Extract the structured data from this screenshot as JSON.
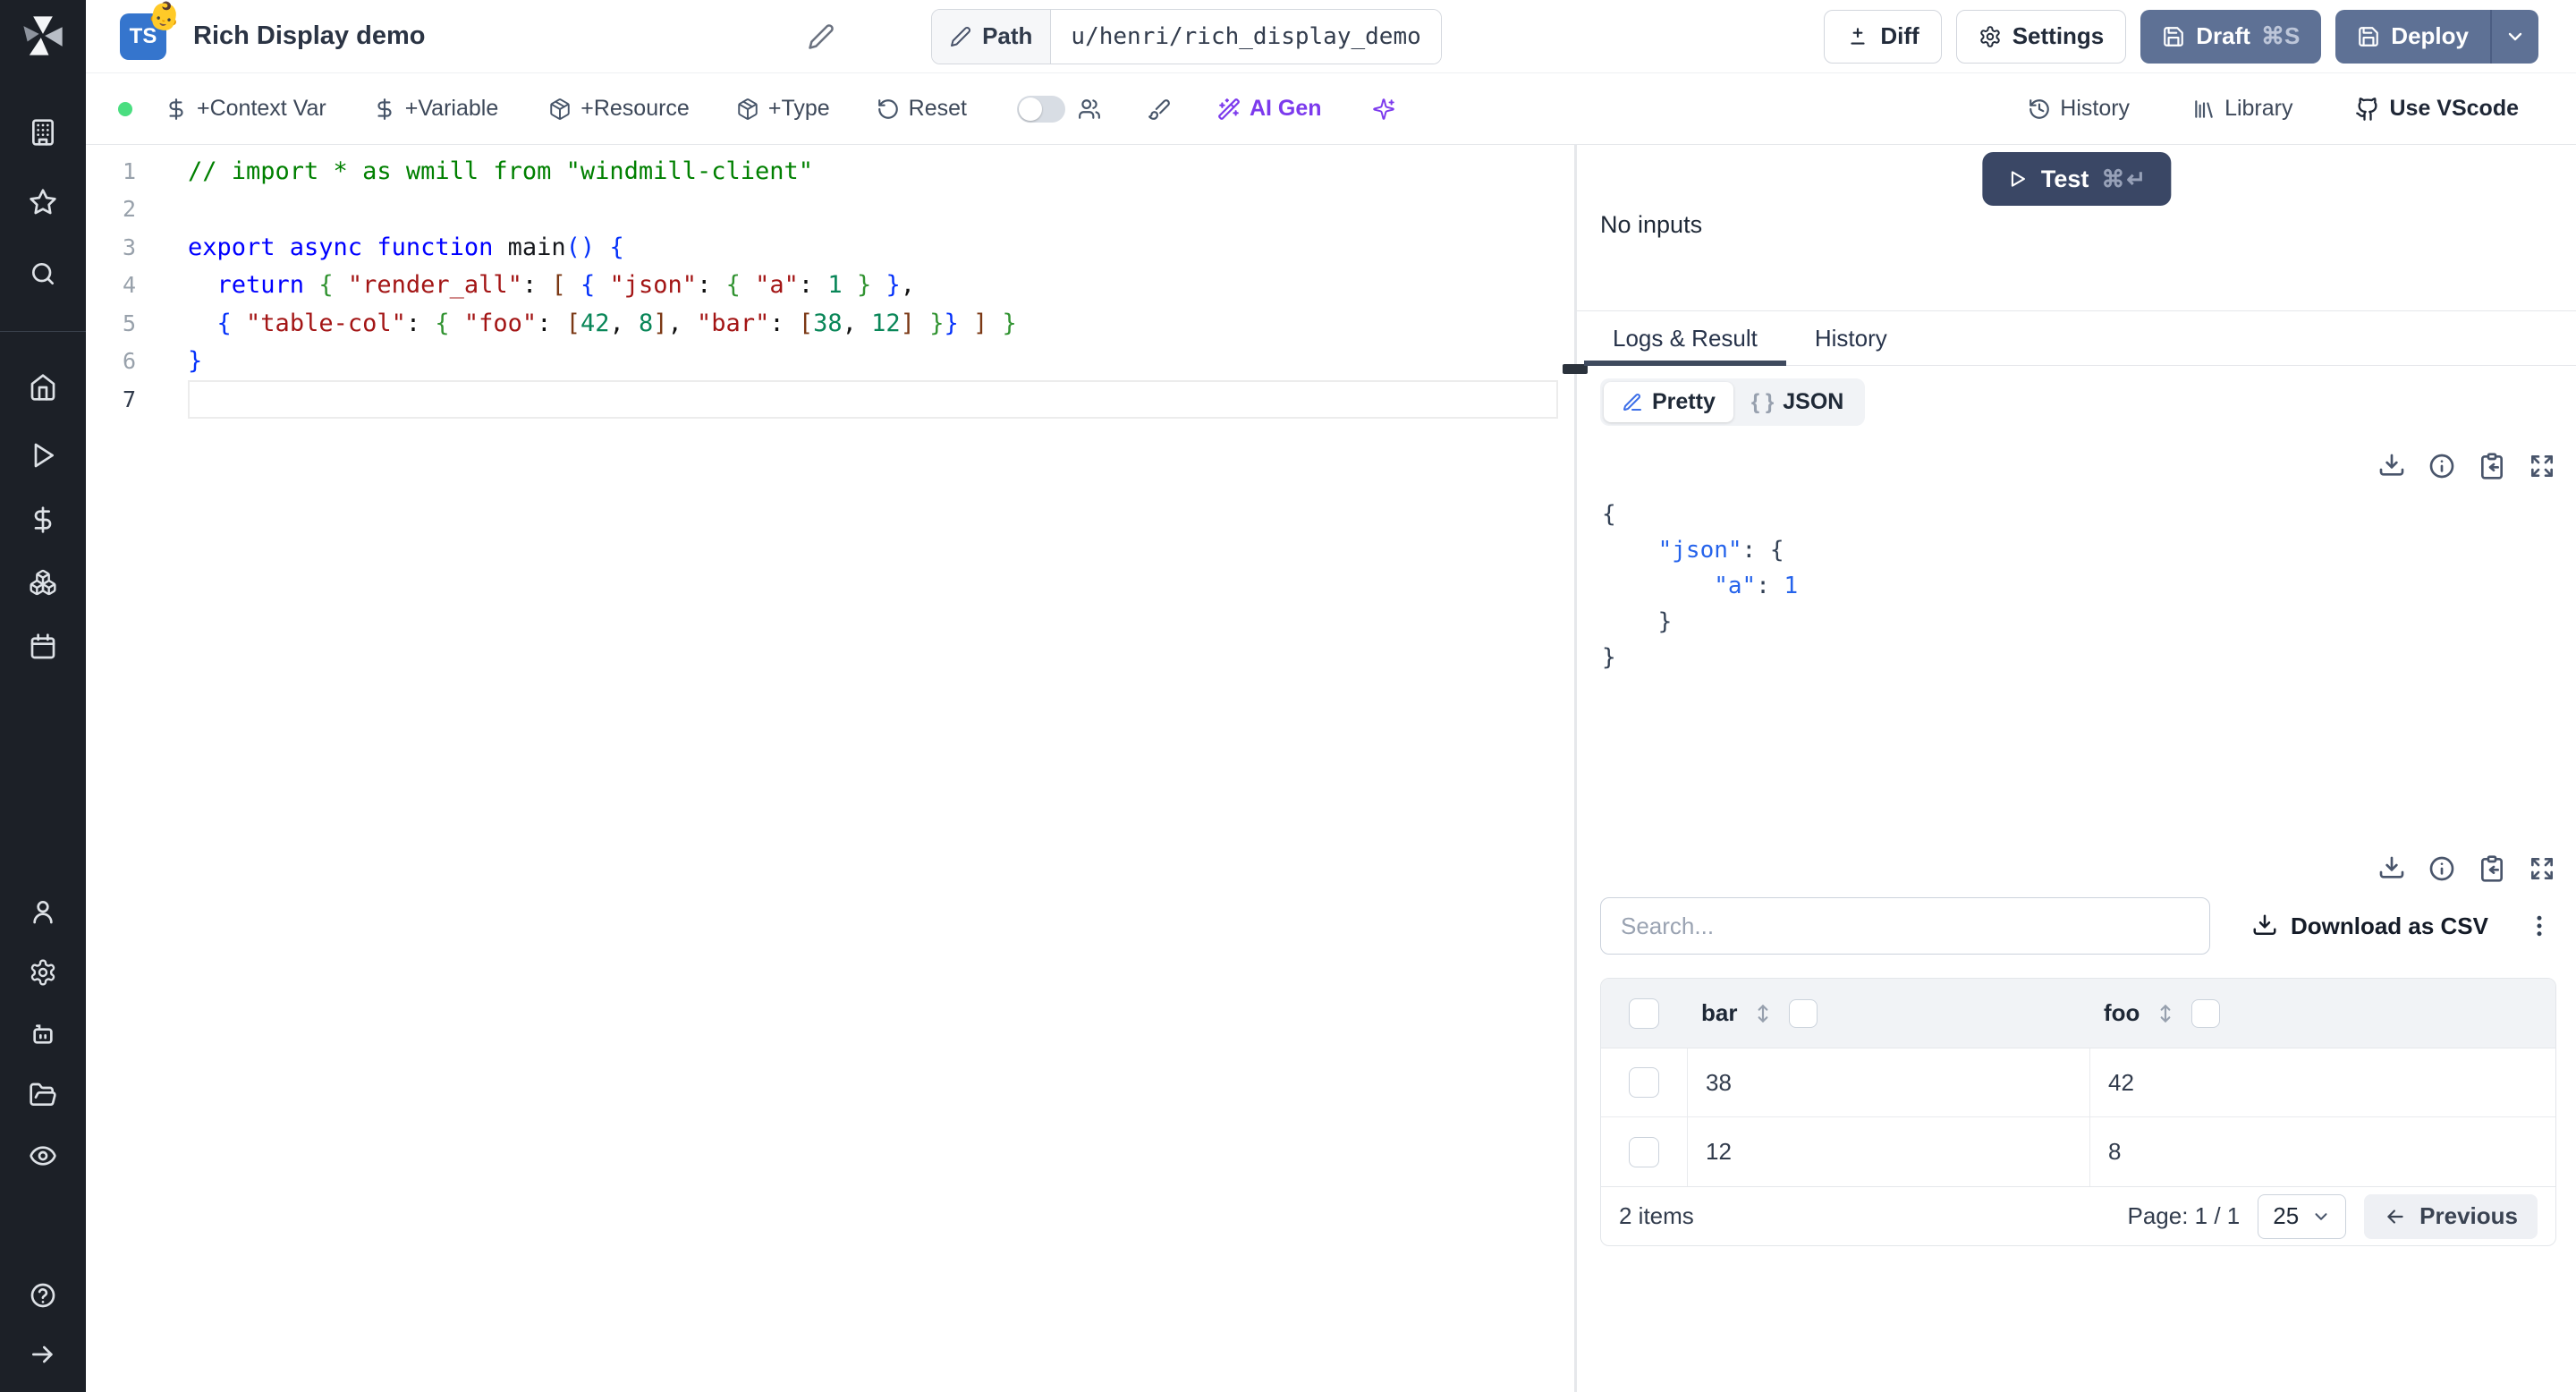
{
  "header": {
    "ts_badge": "TS",
    "emoji": "👶",
    "title": "Rich Display demo",
    "path": {
      "label": "Path",
      "value": "u/henri/rich_display_demo"
    },
    "buttons": {
      "diff": "Diff",
      "settings": "Settings",
      "draft": "Draft",
      "draft_shortcut": "⌘S",
      "deploy": "Deploy"
    }
  },
  "toolbar": {
    "context_var": "+Context Var",
    "variable": "+Variable",
    "resource": "+Resource",
    "type": "+Type",
    "reset": "Reset",
    "ai_gen": "AI Gen",
    "history": "History",
    "library": "Library",
    "vscode": "Use VScode"
  },
  "sidebar": {
    "icons": [
      "windmill-logo",
      "building",
      "star",
      "search",
      "home",
      "play",
      "dollar",
      "boxes",
      "calendar",
      "user",
      "gear",
      "bot",
      "folder-open",
      "eye",
      "help",
      "arrow-right"
    ]
  },
  "editor": {
    "line_numbers": [
      "1",
      "2",
      "3",
      "4",
      "5",
      "6",
      "7"
    ],
    "active_line": 7,
    "lines": [
      [
        {
          "c": "cmt",
          "t": "// import * as wmill from \"windmill-client\""
        }
      ],
      [],
      [
        {
          "c": "kw",
          "t": "export async function "
        },
        {
          "c": "fn",
          "t": "main"
        },
        {
          "c": "b1",
          "t": "()"
        },
        {
          "c": "txt",
          "t": " "
        },
        {
          "c": "b1",
          "t": "{"
        }
      ],
      [
        {
          "c": "txt",
          "t": "  "
        },
        {
          "c": "kw",
          "t": "return"
        },
        {
          "c": "txt",
          "t": " "
        },
        {
          "c": "b2",
          "t": "{"
        },
        {
          "c": "txt",
          "t": " "
        },
        {
          "c": "str",
          "t": "\"render_all\""
        },
        {
          "c": "txt",
          "t": ": "
        },
        {
          "c": "b3",
          "t": "["
        },
        {
          "c": "txt",
          "t": " "
        },
        {
          "c": "b1",
          "t": "{"
        },
        {
          "c": "txt",
          "t": " "
        },
        {
          "c": "str",
          "t": "\"json\""
        },
        {
          "c": "txt",
          "t": ": "
        },
        {
          "c": "b2",
          "t": "{"
        },
        {
          "c": "txt",
          "t": " "
        },
        {
          "c": "str",
          "t": "\"a\""
        },
        {
          "c": "txt",
          "t": ": "
        },
        {
          "c": "num",
          "t": "1"
        },
        {
          "c": "txt",
          "t": " "
        },
        {
          "c": "b2",
          "t": "}"
        },
        {
          "c": "txt",
          "t": " "
        },
        {
          "c": "b1",
          "t": "}"
        },
        {
          "c": "txt",
          "t": ","
        }
      ],
      [
        {
          "c": "txt",
          "t": "  "
        },
        {
          "c": "b1",
          "t": "{"
        },
        {
          "c": "txt",
          "t": " "
        },
        {
          "c": "str",
          "t": "\"table-col\""
        },
        {
          "c": "txt",
          "t": ": "
        },
        {
          "c": "b2",
          "t": "{"
        },
        {
          "c": "txt",
          "t": " "
        },
        {
          "c": "str",
          "t": "\"foo\""
        },
        {
          "c": "txt",
          "t": ": "
        },
        {
          "c": "b3",
          "t": "["
        },
        {
          "c": "num",
          "t": "42"
        },
        {
          "c": "txt",
          "t": ", "
        },
        {
          "c": "num",
          "t": "8"
        },
        {
          "c": "b3",
          "t": "]"
        },
        {
          "c": "txt",
          "t": ", "
        },
        {
          "c": "str",
          "t": "\"bar\""
        },
        {
          "c": "txt",
          "t": ": "
        },
        {
          "c": "b3",
          "t": "["
        },
        {
          "c": "num",
          "t": "38"
        },
        {
          "c": "txt",
          "t": ", "
        },
        {
          "c": "num",
          "t": "12"
        },
        {
          "c": "b3",
          "t": "]"
        },
        {
          "c": "txt",
          "t": " "
        },
        {
          "c": "b2",
          "t": "}"
        },
        {
          "c": "b1",
          "t": "}"
        },
        {
          "c": "txt",
          "t": " "
        },
        {
          "c": "b3",
          "t": "]"
        },
        {
          "c": "txt",
          "t": " "
        },
        {
          "c": "b2",
          "t": "}"
        }
      ],
      [
        {
          "c": "b1",
          "t": "}"
        }
      ],
      []
    ]
  },
  "run_panel": {
    "test": "Test",
    "test_shortcut": "⌘↵",
    "no_inputs": "No inputs",
    "tabs": {
      "logs": "Logs & Result",
      "history": "History"
    },
    "format_toggle": {
      "pretty": "Pretty",
      "json": "JSON",
      "braces": "{ }"
    },
    "json_lines": [
      [
        {
          "c": "p",
          "t": "{"
        }
      ],
      [
        {
          "c": "p",
          "t": "    "
        },
        {
          "c": "key",
          "t": "\"json\""
        },
        {
          "c": "p",
          "t": ": "
        },
        {
          "c": "p",
          "t": "{"
        }
      ],
      [
        {
          "c": "p",
          "t": "        "
        },
        {
          "c": "key",
          "t": "\"a\""
        },
        {
          "c": "p",
          "t": ": "
        },
        {
          "c": "val",
          "t": "1"
        }
      ],
      [
        {
          "c": "p",
          "t": "    "
        },
        {
          "c": "p",
          "t": "}"
        }
      ],
      [
        {
          "c": "p",
          "t": "}"
        }
      ]
    ],
    "search_placeholder": "Search...",
    "download_csv": "Download as CSV",
    "table": {
      "headers": [
        "bar",
        "foo"
      ],
      "rows": [
        [
          "38",
          "42"
        ],
        [
          "12",
          "8"
        ]
      ],
      "footer": {
        "items": "2 items",
        "page": "Page: 1 / 1",
        "page_size": "25",
        "previous": "Previous"
      }
    }
  },
  "colors": {
    "sidebar_bg": "#1c2027",
    "slate_button": "#5e7195",
    "test_button": "#3a4765",
    "ai_accent": "#7c3aed",
    "green_dot": "#4ade80",
    "ts_blue": "#3575cd",
    "tab_underline": "#3f4a5e",
    "json_blue": "#2563eb"
  }
}
